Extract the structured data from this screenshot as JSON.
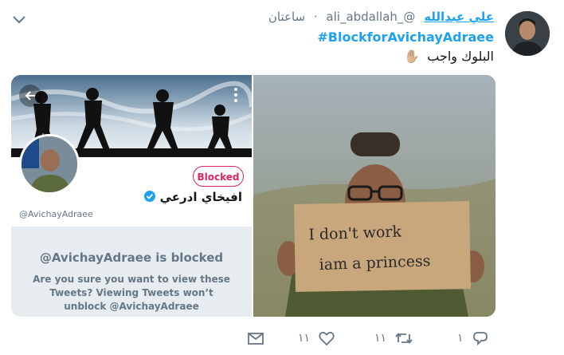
{
  "tweet": {
    "author_name": "علي عبدالله",
    "author_handle": "@_ali_abdallah",
    "separator": "·",
    "time": "ساعتان",
    "hashtag": "#BlockforAvichayAdraee",
    "text": "البلوك واجب",
    "emoji": "✋🏼"
  },
  "media_left": {
    "blocked_button_label": "Blocked",
    "profile_name": "افيخاي ادرعي",
    "profile_handle": "@AvichayAdraee",
    "blocked_title": "@AvichayAdraee is blocked",
    "blocked_description": "Are you sure you want to view these Tweets? Viewing Tweets won’t unblock @AvichayAdraee"
  },
  "media_right": {
    "sign_line1": "I don't work",
    "sign_line2": "iam a princess"
  },
  "actions": {
    "reply_count": "١",
    "retweet_count": "١١",
    "like_count": "١١"
  },
  "colors": {
    "accent": "#1da1f2",
    "blocked": "#e0245e",
    "muted": "#657786"
  }
}
